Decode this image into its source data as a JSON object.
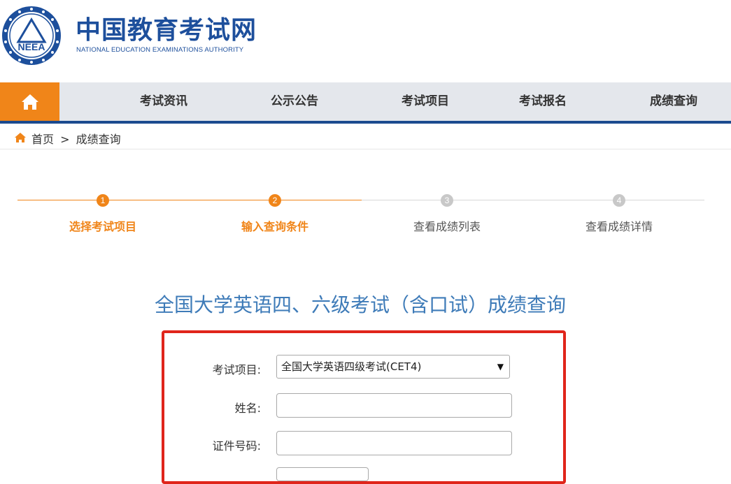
{
  "header": {
    "logo_cn": "中国教育考试网",
    "logo_en": "NATIONAL EDUCATION EXAMINATIONS AUTHORITY",
    "emblem_text": "NEEA"
  },
  "nav": {
    "home_icon": "home-icon",
    "items": [
      {
        "label": "考试资讯"
      },
      {
        "label": "公示公告"
      },
      {
        "label": "考试项目"
      },
      {
        "label": "考试报名"
      },
      {
        "label": "成绩查询"
      }
    ]
  },
  "breadcrumb": {
    "home": "首页",
    "separator": ">",
    "current": "成绩查询"
  },
  "steps": [
    {
      "number": "1",
      "label": "选择考试项目",
      "active": true
    },
    {
      "number": "2",
      "label": "输入查询条件",
      "active": true
    },
    {
      "number": "3",
      "label": "查看成绩列表",
      "active": false
    },
    {
      "number": "4",
      "label": "查看成绩详情",
      "active": false
    }
  ],
  "page_title": "全国大学英语四、六级考试（含口试）成绩查询",
  "form": {
    "exam_label": "考试项目:",
    "exam_value": "全国大学英语四级考试(CET4)",
    "name_label": "姓名:",
    "name_value": "",
    "id_label": "证件号码:",
    "id_value": ""
  },
  "colors": {
    "accent_orange": "#f08519",
    "brand_blue": "#1d4f9c",
    "title_blue": "#3e7bb8",
    "highlight_red": "#e0251b"
  }
}
